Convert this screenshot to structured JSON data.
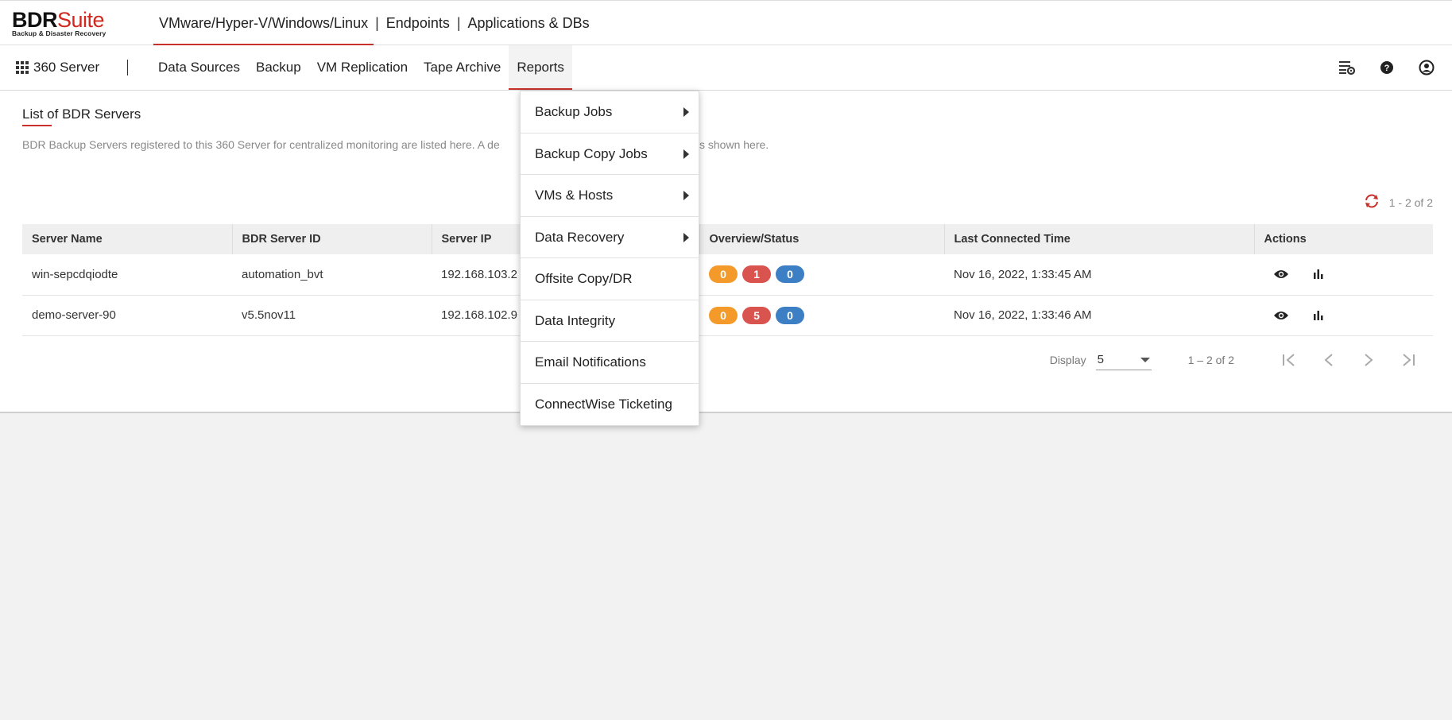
{
  "logo": {
    "bdr": "BDR",
    "suite": "Suite",
    "tagline": "Backup & Disaster Recovery"
  },
  "product_tabs": [
    {
      "label": "VMware/Hyper-V/Windows/Linux",
      "active": true
    },
    {
      "label": "Endpoints",
      "active": false
    },
    {
      "label": "Applications & DBs",
      "active": false
    }
  ],
  "separator": "|",
  "server_switch": {
    "label": "360 Server",
    "icon": "apps-grid-icon"
  },
  "nav": {
    "items": [
      {
        "label": "Data Sources"
      },
      {
        "label": "Backup"
      },
      {
        "label": "VM Replication"
      },
      {
        "label": "Tape Archive"
      },
      {
        "label": "Reports",
        "active": true
      }
    ],
    "icons": [
      "settings-list-icon",
      "help-icon",
      "user-icon"
    ]
  },
  "page": {
    "title": "List of BDR Servers",
    "description": "BDR Backup Servers registered to this 360 Server for centralized monitoring are listed here. A de",
    "description_tail": "s shown here.",
    "count": "1 - 2 of 2"
  },
  "table": {
    "columns": [
      "Server Name",
      "BDR Server ID",
      "Server IP",
      "Overview/Status",
      "Last Connected Time",
      "Actions"
    ],
    "rows": [
      {
        "server_name": "win-sepcdqiodte",
        "server_id": "automation_bvt",
        "server_ip": "192.168.103.2",
        "status": [
          "0",
          "1",
          "0"
        ],
        "last_connected": "Nov 16, 2022, 1:33:45 AM"
      },
      {
        "server_name": "demo-server-90",
        "server_id": "v5.5nov11",
        "server_ip": "192.168.102.9",
        "status": [
          "0",
          "5",
          "0"
        ],
        "last_connected": "Nov 16, 2022, 1:33:46 AM"
      }
    ]
  },
  "pager": {
    "display_label": "Display",
    "display_value": "5",
    "range": "1 – 2 of 2"
  },
  "reports_menu": [
    {
      "label": "Backup Jobs",
      "submenu": true
    },
    {
      "label": "Backup Copy Jobs",
      "submenu": true
    },
    {
      "label": "VMs & Hosts",
      "submenu": true
    },
    {
      "label": "Data Recovery",
      "submenu": true
    },
    {
      "label": "Offsite Copy/DR",
      "submenu": false
    },
    {
      "label": "Data Integrity",
      "submenu": false
    },
    {
      "label": "Email Notifications",
      "submenu": false
    },
    {
      "label": "ConnectWise Ticketing",
      "submenu": false
    }
  ],
  "colors": {
    "brand_red": "#c9302c",
    "badge_orange": "#f39a2b",
    "badge_red": "#d9534f",
    "badge_blue": "#3d7fc4"
  }
}
